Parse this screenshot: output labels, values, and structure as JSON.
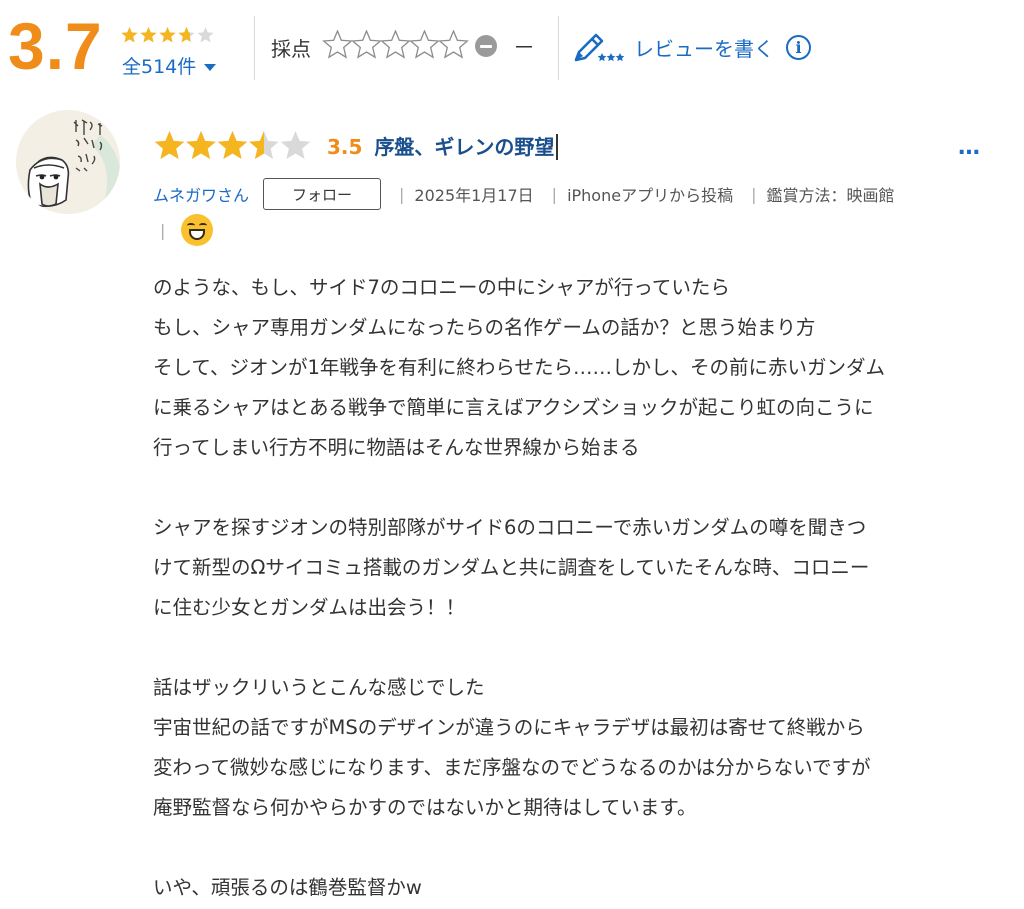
{
  "summary": {
    "average_score": "3.7",
    "average_rating": 3.7,
    "review_count": "全514件"
  },
  "scoring": {
    "label": "採点",
    "current_score": "－",
    "selected_stars": 0
  },
  "write_review": {
    "label": "レビューを書く",
    "info_icon": "i"
  },
  "review": {
    "rating": 3.5,
    "score": "3.5",
    "title": "序盤、ギレンの野望",
    "more_menu": "…",
    "user": "ムネガワさん",
    "follow_label": "フォロー",
    "date": "2025年1月17日",
    "posted_from": "iPhoneアプリから投稿",
    "viewing_method": "鑑賞方法：映画館",
    "reaction_icon": "grinning-face-emoji",
    "body": [
      "のような、もし、サイド7のコロニーの中にシャアが行っていたら",
      "もし、シャア専用ガンダムになったらの名作ゲームの話か？と思う始まり方",
      "そして、ジオンが1年戦争を有利に終わらせたら……しかし、その前に赤いガンダム",
      "に乗るシャアはとある戦争で簡単に言えばアクシズショックが起こり虹の向こうに",
      "行ってしまい行方不明に物語はそんな世界線から始まる",
      "",
      "シャアを探すジオンの特別部隊がサイド6のコロニーで赤いガンダムの噂を聞きつ",
      "けて新型のΩサイコミュ搭載のガンダムと共に調査をしていたそんな時、コロニー",
      "に住む少女とガンダムは出会う！！",
      "",
      "話はザックリいうとこんな感じでした",
      "宇宙世紀の話ですがMSのデザインが違うのにキャラデザは最初は寄せて終戦から",
      "変わって微妙な感じになります、まだ序盤なのでどうなるのかは分からないですが",
      "庵野監督なら何かやらかすのではないかと期待はしています。",
      "",
      "いや、頑張るのは鶴巻監督かw"
    ]
  },
  "colors": {
    "accent_orange": "#f08c1a",
    "link_blue": "#1a6bc4",
    "star_gold": "#f5b51f",
    "star_empty": "#d9d9d9"
  }
}
